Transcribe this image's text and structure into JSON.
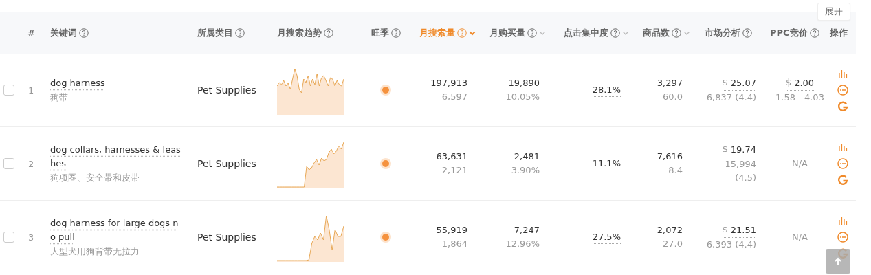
{
  "expand_button": "展开",
  "columns": [
    {
      "label": "#",
      "kind": "plain",
      "sorted": false
    },
    {
      "label": "关键词",
      "kind": "help",
      "sorted": false
    },
    {
      "label": "所属类目",
      "kind": "help",
      "sorted": false
    },
    {
      "label": "月搜索趋势",
      "kind": "help",
      "sorted": false
    },
    {
      "label": "旺季",
      "kind": "help",
      "sorted": false
    },
    {
      "label": "月搜索量",
      "kind": "sortable",
      "sorted": true
    },
    {
      "label": "月购买量",
      "kind": "sortable",
      "sorted": false
    },
    {
      "label": "点击集中度",
      "kind": "sortable",
      "sorted": false
    },
    {
      "label": "商品数",
      "kind": "sortable",
      "sorted": false
    },
    {
      "label": "市场分析",
      "kind": "help",
      "sorted": false
    },
    {
      "label": "PPC竞价",
      "kind": "help",
      "sorted": false
    },
    {
      "label": "操作",
      "kind": "plain",
      "sorted": false
    }
  ],
  "rows": [
    {
      "checked": false,
      "index": "1",
      "keyword": "dog harness",
      "translation": "狗带",
      "category": "Pet Supplies",
      "peak_season": true,
      "searches": "197,913",
      "searches_sub": "6,597",
      "purchases": "19,890",
      "purchases_sub": "10.05%",
      "click_share": "28.1%",
      "products": "3,297",
      "products_sub": "60.0",
      "currency": "$",
      "price": "25.07",
      "market_sub": "6,837 (4.4)",
      "ppc": {
        "kind": "bid",
        "currency": "$",
        "price": "2.00",
        "range": "1.58 - 4.03"
      }
    },
    {
      "checked": false,
      "index": "2",
      "keyword": "dog collars, harnesses & leashes",
      "translation": "狗项圈、安全带和皮带",
      "category": "Pet Supplies",
      "peak_season": true,
      "searches": "63,631",
      "searches_sub": "2,121",
      "purchases": "2,481",
      "purchases_sub": "3.90%",
      "click_share": "11.1%",
      "products": "7,616",
      "products_sub": "8.4",
      "currency": "$",
      "price": "19.74",
      "market_sub": "15,994 (4.5)",
      "ppc": {
        "kind": "na",
        "text": "N/A"
      }
    },
    {
      "checked": false,
      "index": "3",
      "keyword": "dog harness for large dogs no pull",
      "translation": "大型犬用狗背带无拉力",
      "category": "Pet Supplies",
      "peak_season": true,
      "searches": "55,919",
      "searches_sub": "1,864",
      "purchases": "7,247",
      "purchases_sub": "12.96%",
      "click_share": "27.5%",
      "products": "2,072",
      "products_sub": "27.0",
      "currency": "$",
      "price": "21.51",
      "market_sub": "6,393 (4.4)",
      "ppc": {
        "kind": "na",
        "text": "N/A"
      }
    }
  ]
}
